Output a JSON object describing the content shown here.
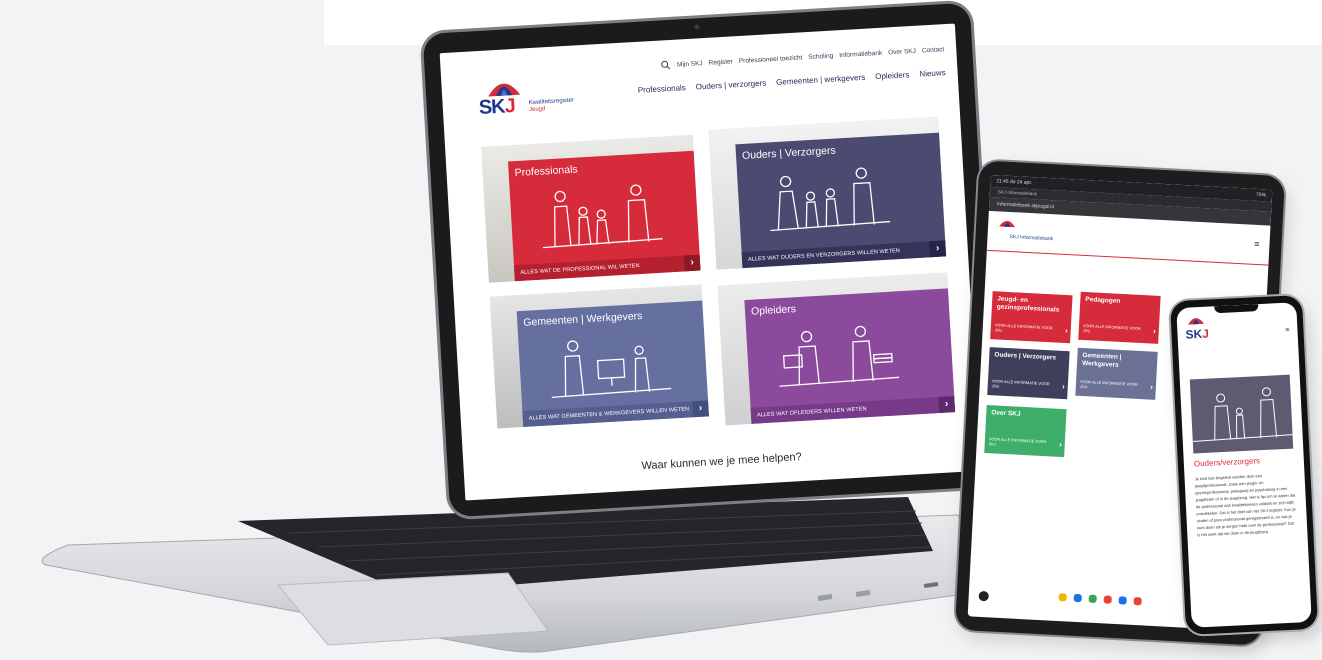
{
  "laptop": {
    "logo": {
      "letters": "SK",
      "letter_j": "J",
      "sub_line1": "Kwaliteitsregister",
      "sub_line2": "Jeugd"
    },
    "utility_nav": [
      "Mijn SKJ",
      "Register",
      "Professioneel toezicht",
      "Scholing",
      "Informatiebank",
      "Over SKJ",
      "Contact"
    ],
    "main_nav": [
      "Professionals",
      "Ouders | verzorgers",
      "Gemeenten | werkgevers",
      "Opleiders",
      "Nieuws"
    ],
    "tiles": [
      {
        "title": "Professionals",
        "link": "ALLES WAT DE PROFESSIONAL WIL WETEN",
        "color": "#d52b3a"
      },
      {
        "title": "Ouders | Verzorgers",
        "link": "ALLES WAT OUDERS EN VERZORGERS WILLEN WETEN",
        "color": "#3f3f6b"
      },
      {
        "title": "Gemeenten | Werkgevers",
        "link": "ALLES WAT GEMEENTEN & WERKGEVERS WILLEN WETEN",
        "color": "#5a6491"
      },
      {
        "title": "Opleiders",
        "link": "ALLES WAT OPLEIDERS WILLEN WETEN",
        "color": "#7a3c8c"
      }
    ],
    "question": "Waar kunnen we je mee helpen?"
  },
  "tablet": {
    "status_time": "11:45  do 24 apr.",
    "status_battery": "75%",
    "tab_label": "SKJ Informatiebank",
    "url": "informatiebank.skjeugd.nl",
    "logo_label": "SKJ Informatiebank",
    "menu_icon": "≡",
    "cards": [
      {
        "title": "Jeugd- en gezinsprofessionals",
        "sub": "VOOR ALLE INFORMATIE VOOR JOU",
        "color": "#d52b3a"
      },
      {
        "title": "Pedagogen",
        "sub": "VOOR ALLE INFORMATIE VOOR JOU",
        "color": "#d52b3a"
      },
      {
        "title": "Ouders | Verzorgers",
        "sub": "VOOR ALLE INFORMATIE VOOR JOU",
        "color": "#3f3f5c"
      },
      {
        "title": "Gemeenten | Werkgevers",
        "sub": "VOOR ALLE INFORMATIE VOOR JOU",
        "color": "#6b7296"
      },
      {
        "title": "Over SKJ",
        "sub": "VOOR ALLE INFORMATIE OVER SKJ",
        "color": "#3fae6a"
      }
    ]
  },
  "phone": {
    "logo_letters": "SK",
    "logo_j": "J",
    "menu_icon": "≡",
    "title": "Ouders/verzorgers",
    "body": "Je kind kan begeleid worden door een jeugdprofessional, zoals een jeugd- en gezinsprofessional, pedagoog en psycholoog in een jeugdteam of in de jeugdzorg. Het is fijn om te weten dat de professional aan kwaliteitseisen voldoet en zich blijft ontwikkelen. Dat is het doel van het SKJ-register. Kun je vinden of jouw professional geregistreerd is, en wat je kunt doen als je zorgen hebt over de professional? Dat is het werk dat we doen in de jeugdzorg."
  }
}
